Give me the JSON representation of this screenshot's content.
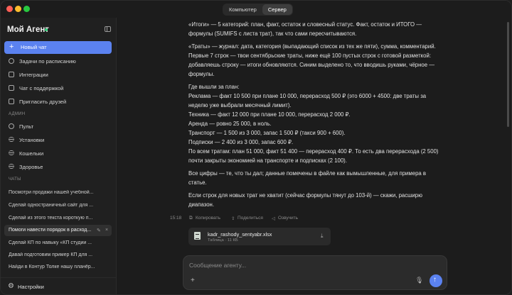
{
  "titlebar": {
    "tabs": [
      {
        "label": "Компьютер",
        "active": false
      },
      {
        "label": "Сервер",
        "active": true
      }
    ]
  },
  "sidebar": {
    "title": "Мой Агент",
    "status_color": "#33d17a",
    "new_chat": "Новый чат",
    "nav": [
      {
        "label": "Задачи по расписанию",
        "icon": "clock-icon"
      },
      {
        "label": "Интеграции",
        "icon": "plug-icon"
      },
      {
        "label": "Чат с поддержкой",
        "icon": "support-chat-icon"
      },
      {
        "label": "Пригласить друзей",
        "icon": "gift-icon"
      }
    ],
    "admin_label": "АДМИН",
    "admin": [
      {
        "label": "Пульт",
        "icon": "dashboard-icon"
      },
      {
        "label": "Установки",
        "icon": "settings-sliders-icon"
      },
      {
        "label": "Кошельки",
        "icon": "wallet-icon"
      },
      {
        "label": "Здоровье",
        "icon": "health-icon"
      }
    ],
    "chats_label": "ЧАТЫ",
    "chats": [
      "Посмотри продажи нашей учебной...",
      "Сделай одностраничный сайт для ...",
      "Сделай из этого текста короткую п...",
      "Помоги навести порядок в расход...",
      "Сделай КП по навыку «КП студии ...",
      "Давай подготовим пример КП для ...",
      "Найди в Контур Толке нашу планёр..."
    ],
    "active_chat_index": 3,
    "settings": "Настройки"
  },
  "message": {
    "paragraphs": [
      "«Итоги» — 5 категорий: план, факт, остаток и словесный статус. Факт, остаток и ИТОГО — формулы (SUMIFS с листа трат), так что сами пересчитываются.",
      "«Траты» — журнал: дата, категория (выпадающий список из тех же пяти), сумма, комментарий. Первые 7 строк — твои сентябрьские траты, ниже ещё 100 пустых строк с готовой разметкой: добавляешь строку — итоги обновляются. Синим выделено то, что вводишь руками, чёрное — формулы.",
      "Где вышли за план:\nРеклама — факт 10 500 при плане 10 000, перерасход 500 ₽ (это 6000 + 4500: две траты за неделю уже выбрали месячный лимит).\nТехника — факт 12 000 при плане 10 000, перерасход 2 000 ₽.\nАренда — ровно 25 000, в ноль.\nТранспорт — 1 500 из 3 000, запас 1 500 ₽ (такси 900 + 600).\nПодписки — 2 400 из 3 000, запас 600 ₽.\nПо всем тратам: план 51 000, факт 51 400 — перерасход 400 ₽. То есть два перерасхода (2 500) почти закрыты экономией на транспорте и подписках (2 100).",
      "Все цифры — те, что ты дал; данные помечены в файле как вымышленные, для примера в статье.",
      "Если строк для новых трат не хватит (сейчас формулы тянут до 103-й) — скажи, расширю диапазон."
    ],
    "time": "15:18",
    "actions": {
      "copy": "Копировать",
      "share": "Поделиться",
      "speak": "Озвучить"
    }
  },
  "file": {
    "name": "kadr_rashody_sentyabr.xlsx",
    "meta": "Таблица · 11 КБ"
  },
  "composer": {
    "placeholder": "Сообщение агенту..."
  },
  "colors": {
    "accent": "#5b82f0",
    "background": "#1c1c1c",
    "sidebar": "#202020"
  }
}
